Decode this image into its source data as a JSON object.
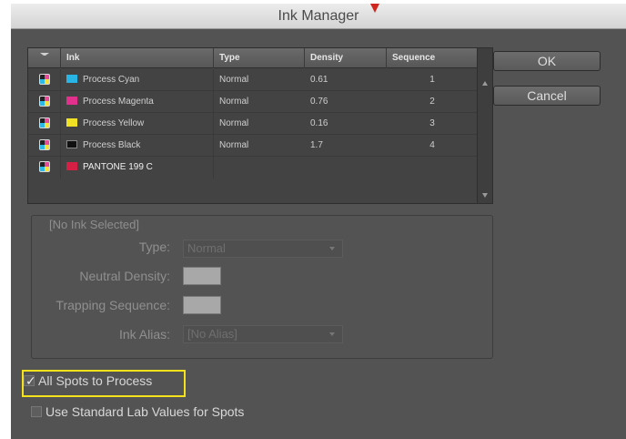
{
  "window": {
    "title": "Ink Manager"
  },
  "table": {
    "headers": {
      "ink": "Ink",
      "type": "Type",
      "density": "Density",
      "sequence": "Sequence"
    },
    "rows": [
      {
        "name": "Process Cyan",
        "type": "Normal",
        "density": "0.61",
        "sequence": "1",
        "swatch": "#29b4e6"
      },
      {
        "name": "Process Magenta",
        "type": "Normal",
        "density": "0.76",
        "sequence": "2",
        "swatch": "#e2318c"
      },
      {
        "name": "Process Yellow",
        "type": "Normal",
        "density": "0.16",
        "sequence": "3",
        "swatch": "#f1e125"
      },
      {
        "name": "Process Black",
        "type": "Normal",
        "density": "1.7",
        "sequence": "4",
        "swatch": "#111111"
      },
      {
        "name": "PANTONE 199 C",
        "type": "",
        "density": "",
        "sequence": "",
        "swatch": "#d61f45"
      }
    ]
  },
  "buttons": {
    "ok": "OK",
    "cancel": "Cancel"
  },
  "details": {
    "group_title": "[No Ink Selected]",
    "type_label": "Type:",
    "type_value": "Normal",
    "density_label": "Neutral Density:",
    "trapping_label": "Trapping Sequence:",
    "alias_label": "Ink Alias:",
    "alias_value": "[No Alias]"
  },
  "options": {
    "all_spots": {
      "label": "All Spots to Process",
      "checked": true
    },
    "standard_lab": {
      "label": "Use Standard Lab Values for Spots",
      "checked": false
    }
  },
  "colors": {
    "panel": "#535353",
    "highlight": "#f5e21a",
    "title_mark": "#d0261f"
  }
}
